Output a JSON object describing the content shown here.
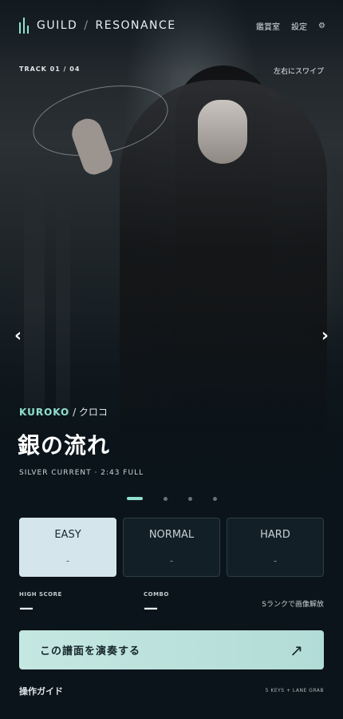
{
  "header": {
    "brand_left": "GUILD",
    "brand_sep": "/",
    "brand_right": "RESONANCE",
    "nav": [
      "鑑賞室",
      "設定"
    ],
    "settings_icon": "gear-icon"
  },
  "track": {
    "counter": "TRACK 01 / 04",
    "swipe_hint": "左右にスワイプ",
    "artist_en": "KUROKO",
    "artist_jp": "/ クロコ",
    "title": "銀の流れ",
    "subtitle": "SILVER CURRENT · 2:43 FULL",
    "current_page": 1,
    "total_pages": 4
  },
  "navigation": {
    "prev_icon": "‹",
    "next_icon": "›"
  },
  "difficulties": [
    {
      "name": "EASY",
      "value": "-",
      "selected": true
    },
    {
      "name": "NORMAL",
      "value": "-",
      "selected": false
    },
    {
      "name": "HARD",
      "value": "-",
      "selected": false
    }
  ],
  "stats": {
    "high_score_label": "HIGH SCORE",
    "high_score_value": "—",
    "combo_label": "COMBO",
    "combo_value": "—",
    "unlock_hint": "Sランクで画像解放"
  },
  "play": {
    "label": "この譜面を演奏する",
    "icon": "↗"
  },
  "footer": {
    "guide_label": "操作ガイド",
    "keys_info": "5 KEYS + LANE GRAB"
  },
  "colors": {
    "accent": "#8fe0d0",
    "background": "#0b141a",
    "selected_difficulty": "#d4e6ec",
    "play_button": "#c5e7e1"
  }
}
